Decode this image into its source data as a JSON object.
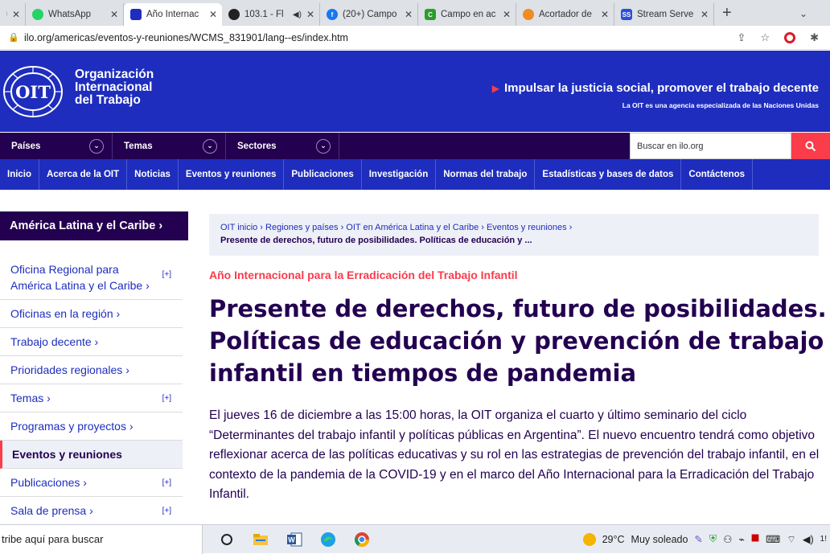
{
  "browser": {
    "tabs": [
      {
        "title": "u",
        "color": "#f3a"
      },
      {
        "title": "WhatsApp",
        "color": "#25d366"
      },
      {
        "title": "Año Internac",
        "color": "#1e2dbe"
      },
      {
        "title": "103.1 - Fl",
        "color": "#222"
      },
      {
        "title": "(20+) Campo",
        "color": "#1877f2"
      },
      {
        "title": "Campo en ac",
        "color": "#2a9d2a"
      },
      {
        "title": "Acortador de",
        "color": "#f28b20"
      },
      {
        "title": "Stream Serve",
        "color": "#2b4fd6"
      }
    ],
    "new_tab": "+",
    "url": "ilo.org/americas/eventos-y-reuniones/WCMS_831901/lang--es/index.htm"
  },
  "header": {
    "logo_lines": [
      "Organización",
      "Internacional",
      "del Trabajo"
    ],
    "slogan": "Impulsar la justicia social, promover el trabajo decente",
    "subslogan": "La OIT es una agencia especializada de las Naciones Unidas"
  },
  "nav_top": {
    "items": [
      "Países",
      "Temas",
      "Sectores"
    ],
    "search_placeholder": "Buscar en ilo.org"
  },
  "nav_main": {
    "items": [
      "Inicio",
      "Acerca de la OIT",
      "Noticias",
      "Eventos y reuniones",
      "Publicaciones",
      "Investigación",
      "Normas del trabajo",
      "Estadísticas y bases de datos",
      "Contáctenos"
    ]
  },
  "sidebar": {
    "heading": "América Latina y el Caribe ›",
    "items": [
      {
        "label": "Oficina Regional para América Latina y el Caribe ›",
        "plus": "[+]"
      },
      {
        "label": "Oficinas en la región ›",
        "plus": ""
      },
      {
        "label": "Trabajo decente ›",
        "plus": ""
      },
      {
        "label": "Prioridades regionales ›",
        "plus": ""
      },
      {
        "label": "Temas ›",
        "plus": "[+]"
      },
      {
        "label": "Programas y proyectos ›",
        "plus": ""
      },
      {
        "label": "Eventos y reuniones",
        "plus": ""
      },
      {
        "label": "Publicaciones ›",
        "plus": "[+]"
      },
      {
        "label": "Sala de prensa ›",
        "plus": "[+]"
      }
    ]
  },
  "breadcrumb": {
    "links": "OIT inicio › Regiones y países › OIT en América Latina y el Caribe › Eventos y reuniones ›",
    "current": "Presente de derechos, futuro de posibilidades. Políticas de educación y ..."
  },
  "article": {
    "kicker": "Año Internacional para la Erradicación del Trabajo Infantil",
    "title": "Presente de derechos, futuro de posibilidades. Políticas de educación y prevención de trabajo infantil en tiempos de pandemia",
    "body": "El jueves 16 de diciembre a las 15:00 horas, la OIT organiza el cuarto y último seminario del ciclo “Determinantes del trabajo infantil y políticas públicas en Argentina”. El nuevo encuentro tendrá como objetivo reflexionar acerca de las políticas educativas y su rol en las estrategias de prevención del trabajo infantil, en el contexto de la pandemia de la COVID-19 y en el marco del Año Internacional para la Erradicación del Trabajo Infantil."
  },
  "taskbar": {
    "search_text": "tribe aquí para buscar",
    "temperature": "29°C",
    "weather": "Muy soleado",
    "clock_fragment": "1!"
  }
}
